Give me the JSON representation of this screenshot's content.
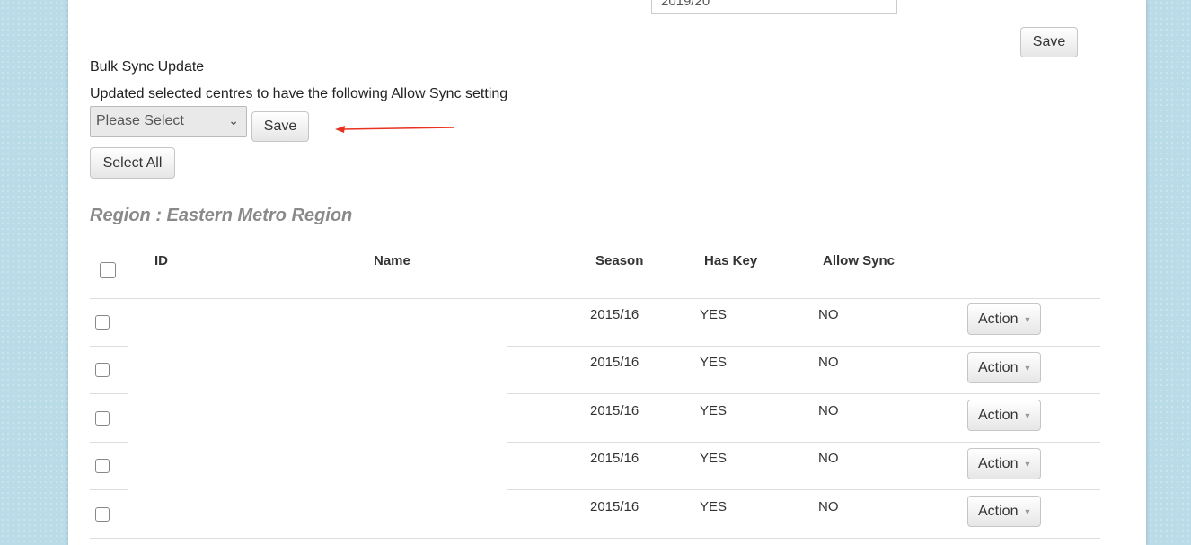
{
  "season_field": {
    "value": "2019/20"
  },
  "top_save_label": "Save",
  "bulk": {
    "title": "Bulk Sync Update",
    "description": "Updated selected centres to have the following Allow Sync setting",
    "select_value": "Please Select",
    "save_label": "Save",
    "select_all_label": "Select All"
  },
  "annotation": {
    "arrow_color": "#e8321e"
  },
  "region_heading": "Region : Eastern Metro Region",
  "table": {
    "columns": [
      "ID",
      "Name",
      "Season",
      "Has Key",
      "Allow Sync"
    ],
    "rows": [
      {
        "season": "2015/16",
        "has_key": "YES",
        "allow_sync": "NO",
        "action": "Action"
      },
      {
        "season": "2015/16",
        "has_key": "YES",
        "allow_sync": "NO",
        "action": "Action"
      },
      {
        "season": "2015/16",
        "has_key": "YES",
        "allow_sync": "NO",
        "action": "Action"
      },
      {
        "season": "2015/16",
        "has_key": "YES",
        "allow_sync": "NO",
        "action": "Action"
      },
      {
        "season": "2015/16",
        "has_key": "YES",
        "allow_sync": "NO",
        "action": "Action"
      }
    ]
  }
}
